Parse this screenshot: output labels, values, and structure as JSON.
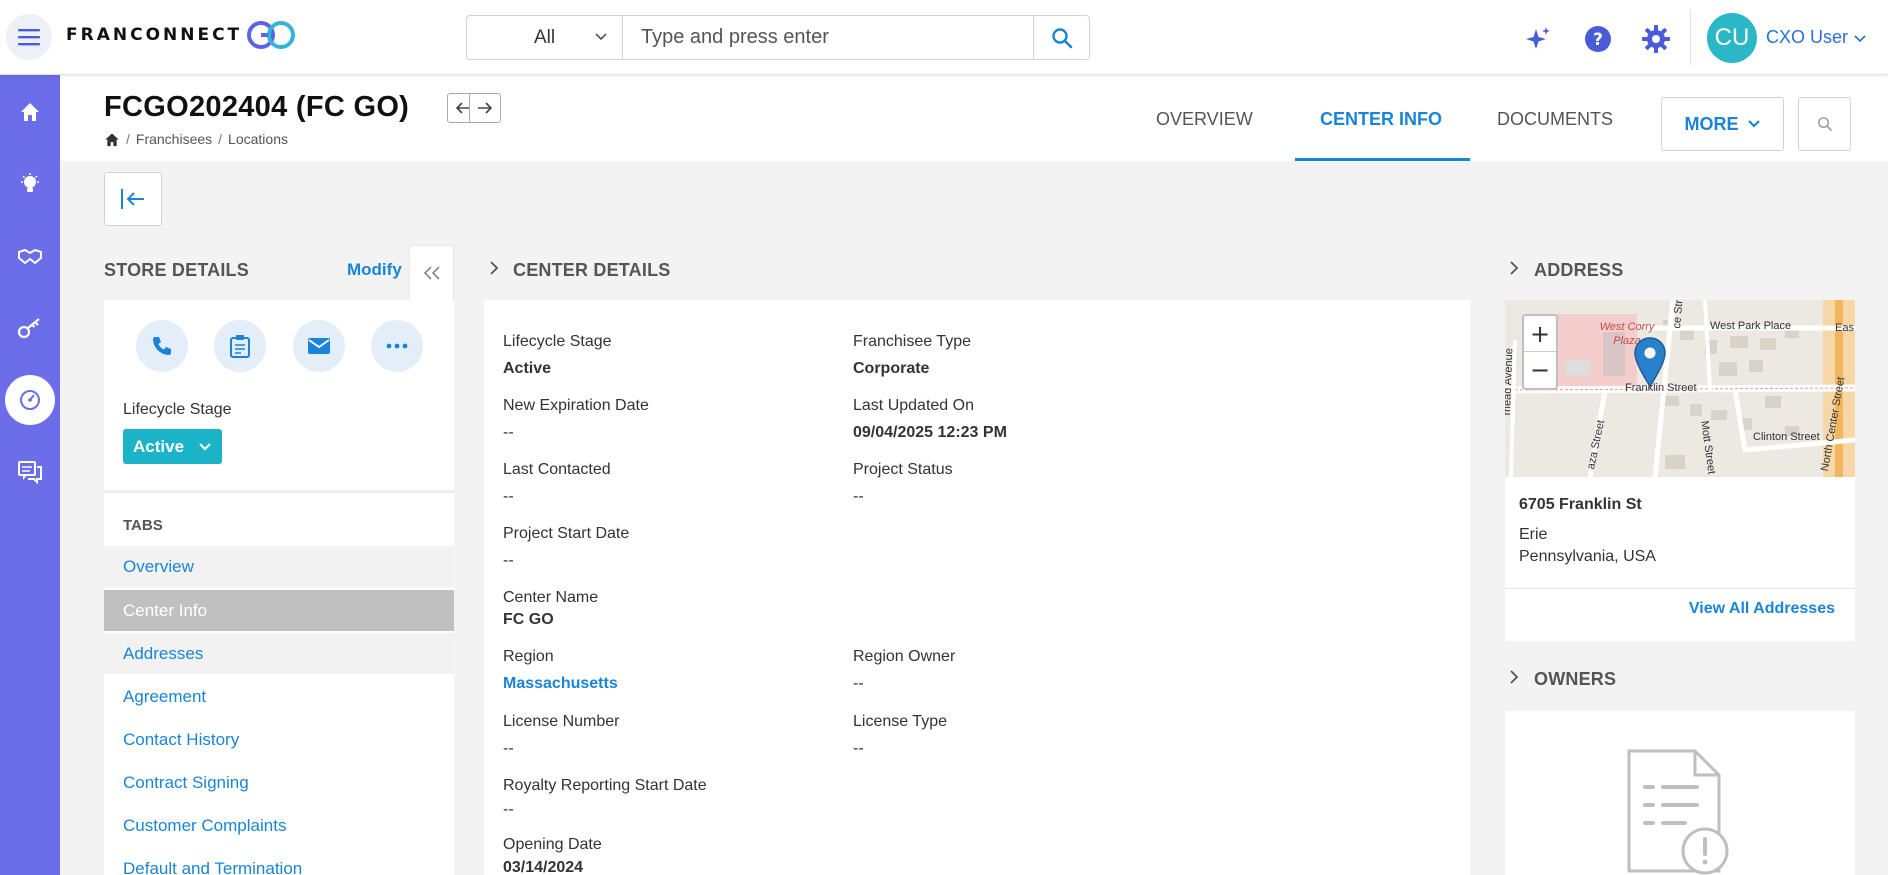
{
  "app": {
    "logo_text": "FRANCONNECT"
  },
  "search": {
    "category": "All",
    "placeholder": "Type and press enter"
  },
  "user": {
    "initials": "CU",
    "name": "CXO User"
  },
  "page": {
    "title": "FCGO202404 (FC GO)",
    "breadcrumb": [
      "Franchisees",
      "Locations"
    ],
    "tabs": [
      "OVERVIEW",
      "CENTER INFO",
      "DOCUMENTS"
    ],
    "active_tab": "CENTER INFO",
    "more_label": "MORE"
  },
  "store": {
    "title": "STORE DETAILS",
    "modify_label": "Modify",
    "lifecycle_label": "Lifecycle Stage",
    "lifecycle_value": "Active",
    "tabs_title": "TABS",
    "tabs": [
      "Overview",
      "Center Info",
      "Addresses",
      "Agreement",
      "Contact History",
      "Contract Signing",
      "Customer Complaints",
      "Default and Termination"
    ]
  },
  "center": {
    "title": "CENTER DETAILS",
    "fields": {
      "lifecycle_stage": {
        "label": "Lifecycle Stage",
        "value": "Active"
      },
      "franchisee_type": {
        "label": "Franchisee Type",
        "value": "Corporate"
      },
      "new_expiration": {
        "label": "New Expiration Date",
        "value": "--"
      },
      "last_updated": {
        "label": "Last Updated On",
        "value": "09/04/2025 12:23 PM"
      },
      "last_contacted": {
        "label": "Last Contacted",
        "value": "--"
      },
      "project_status": {
        "label": "Project Status",
        "value": "--"
      },
      "project_start": {
        "label": "Project Start Date",
        "value": "--"
      },
      "center_name": {
        "label": "Center Name",
        "value": "FC GO"
      },
      "region": {
        "label": "Region",
        "value": "Massachusetts"
      },
      "region_owner": {
        "label": "Region Owner",
        "value": "--"
      },
      "license_number": {
        "label": "License Number",
        "value": "--"
      },
      "license_type": {
        "label": "License Type",
        "value": "--"
      },
      "royalty_start": {
        "label": "Royalty Reporting Start Date",
        "value": "--"
      },
      "opening_date": {
        "label": "Opening Date",
        "value": "03/14/2024"
      }
    }
  },
  "address": {
    "title": "ADDRESS",
    "street": "6705 Franklin St",
    "city": "Erie",
    "state_country": "Pennsylvania, USA",
    "view_all": "View All Addresses",
    "map_labels": {
      "plaza": "West Corry Plaza",
      "park": "West Park Place",
      "franklin": "Franklin Street",
      "clinton": "Clinton Street",
      "mott": "Mott Street",
      "north_center": "North Center Street",
      "mead": "mead Avenue",
      "plaza_street": "aza Street",
      "ce_street": "ce Stre",
      "ea": "Eas"
    },
    "zoom_in": "+",
    "zoom_out": "−"
  },
  "owners": {
    "title": "OWNERS"
  },
  "colors": {
    "accent": "#1a84d8",
    "rail": "#6b6ee8",
    "badge": "#1ab3c7",
    "avatar": "#2bb8c6"
  }
}
